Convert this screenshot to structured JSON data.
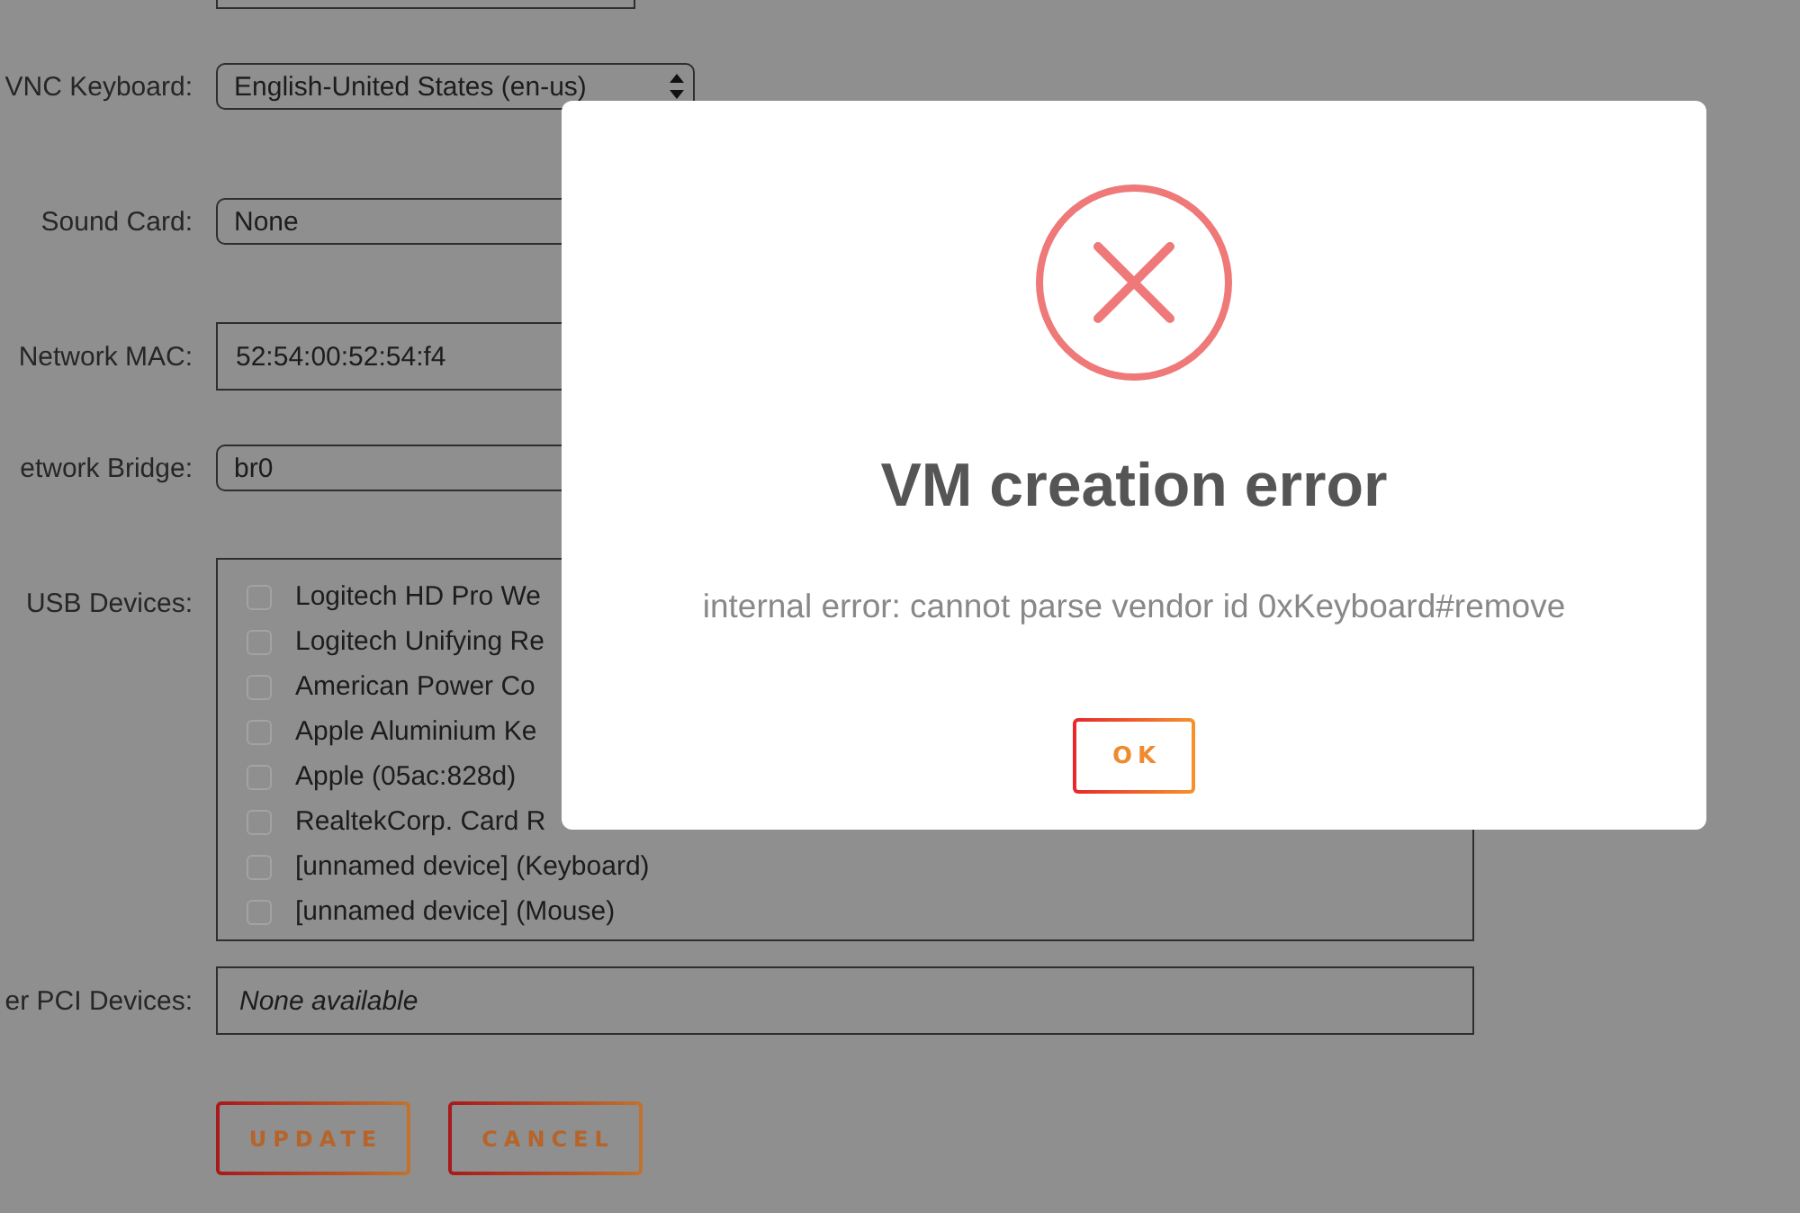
{
  "form": {
    "fields": [
      {
        "kind": "input"
      },
      {
        "kind": "select",
        "label": "VNC Keyboard:",
        "value": "English-United States (en-us)"
      },
      {
        "kind": "menu",
        "label": "Sound Card:",
        "value": "None"
      },
      {
        "kind": "input",
        "label": "Network MAC:",
        "value": "52:54:00:52:54:f4"
      },
      {
        "kind": "menu",
        "label": "etwork Bridge:",
        "value": "br0"
      },
      {
        "kind": "checklist",
        "label": "USB Devices:",
        "items": [
          {
            "label": "Logitech HD Pro We",
            "checked": false
          },
          {
            "label": "Logitech Unifying Re",
            "checked": false
          },
          {
            "label": "American Power Co",
            "checked": false
          },
          {
            "label": "Apple Aluminium Ke",
            "checked": false
          },
          {
            "label": "Apple (05ac:828d)",
            "checked": false
          },
          {
            "label": "RealtekCorp. Card R",
            "checked": false
          },
          {
            "label": "[unnamed device] (Keyboard)",
            "checked": false
          },
          {
            "label": "[unnamed device] (Mouse)",
            "checked": false
          }
        ]
      },
      {
        "kind": "static",
        "label": "er PCI Devices:",
        "value": "None available"
      }
    ],
    "buttons": [
      {
        "label": "UPDATE"
      },
      {
        "label": "CANCEL"
      }
    ]
  },
  "dialog": {
    "title": "VM creation error",
    "message": "internal error: cannot parse vendor id 0xKeyboard#remove",
    "buttons": [
      {
        "label": "OK"
      }
    ]
  }
}
